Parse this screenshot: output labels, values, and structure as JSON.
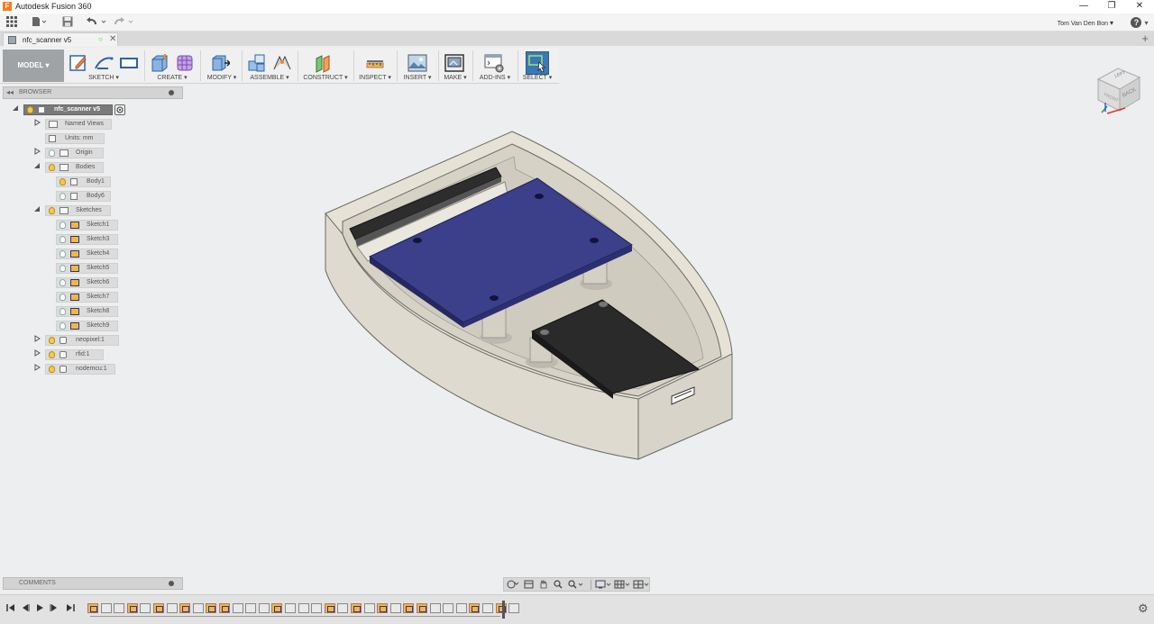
{
  "window": {
    "title": "Autodesk Fusion 360",
    "app_icon_letter": "F",
    "controls": [
      "—",
      "❐",
      "✕"
    ]
  },
  "quick_access": {
    "user_name": "Tom Van Den Bon",
    "user_chevron": "▾",
    "help_label": "?",
    "help_chevron": "▾"
  },
  "document_tab": {
    "name": "nfc_scanner v5",
    "sync": "○",
    "close": "✕",
    "add": "+"
  },
  "ribbon": {
    "workspace": "MODEL ▾",
    "groups": [
      {
        "id": "sketch",
        "label": "SKETCH ▾"
      },
      {
        "id": "create",
        "label": "CREATE ▾"
      },
      {
        "id": "modify",
        "label": "MODIFY ▾"
      },
      {
        "id": "assemble",
        "label": "ASSEMBLE ▾"
      },
      {
        "id": "construct",
        "label": "CONSTRUCT ▾"
      },
      {
        "id": "inspect",
        "label": "INSPECT ▾"
      },
      {
        "id": "insert",
        "label": "INSERT ▾"
      },
      {
        "id": "make",
        "label": "MAKE ▾"
      },
      {
        "id": "addins",
        "label": "ADD-INS ▾"
      },
      {
        "id": "select",
        "label": "SELECT ▾"
      }
    ]
  },
  "viewcube": {
    "faces": [
      "LEFT",
      "FRONT",
      "BACK"
    ]
  },
  "browser": {
    "title": "BROWSER",
    "collapse": "◂◂",
    "tree": [
      {
        "label": "nfc_scanner v5",
        "depth": 0,
        "expand": "open",
        "bulb": true,
        "icon": "doc",
        "root": true
      },
      {
        "label": "Named Views",
        "depth": 1,
        "expand": "closed",
        "bulb": false,
        "icon": "folder"
      },
      {
        "label": "Units: mm",
        "depth": 1,
        "expand": "none",
        "bulb": false,
        "icon": "doc"
      },
      {
        "label": "Origin",
        "depth": 1,
        "expand": "closed",
        "bulb": true,
        "bulb_off": true,
        "icon": "folder"
      },
      {
        "label": "Bodies",
        "depth": 1,
        "expand": "open",
        "bulb": true,
        "icon": "folder"
      },
      {
        "label": "Body1",
        "depth": 2,
        "expand": "none",
        "bulb": true,
        "icon": "body"
      },
      {
        "label": "Body6",
        "depth": 2,
        "expand": "none",
        "bulb": true,
        "bulb_off": true,
        "icon": "body"
      },
      {
        "label": "Sketches",
        "depth": 1,
        "expand": "open",
        "bulb": true,
        "icon": "folder"
      },
      {
        "label": "Sketch1",
        "depth": 2,
        "expand": "none",
        "bulb": true,
        "bulb_off": true,
        "icon": "sketch"
      },
      {
        "label": "Sketch3",
        "depth": 2,
        "expand": "none",
        "bulb": true,
        "bulb_off": true,
        "icon": "sketch"
      },
      {
        "label": "Sketch4",
        "depth": 2,
        "expand": "none",
        "bulb": true,
        "bulb_off": true,
        "icon": "sketch"
      },
      {
        "label": "Sketch5",
        "depth": 2,
        "expand": "none",
        "bulb": true,
        "bulb_off": true,
        "icon": "sketch"
      },
      {
        "label": "Sketch6",
        "depth": 2,
        "expand": "none",
        "bulb": true,
        "bulb_off": true,
        "icon": "sketch"
      },
      {
        "label": "Sketch7",
        "depth": 2,
        "expand": "none",
        "bulb": true,
        "bulb_off": true,
        "icon": "sketch"
      },
      {
        "label": "Sketch8",
        "depth": 2,
        "expand": "none",
        "bulb": true,
        "bulb_off": true,
        "icon": "sketch"
      },
      {
        "label": "Sketch9",
        "depth": 2,
        "expand": "none",
        "bulb": true,
        "bulb_off": true,
        "icon": "sketch"
      },
      {
        "label": "neopixel:1",
        "depth": 1,
        "expand": "closed",
        "bulb": true,
        "icon": "component"
      },
      {
        "label": "rfid:1",
        "depth": 1,
        "expand": "closed",
        "bulb": true,
        "icon": "component"
      },
      {
        "label": "nodemcu:1",
        "depth": 1,
        "expand": "closed",
        "bulb": true,
        "icon": "component"
      }
    ]
  },
  "comments": {
    "title": "COMMENTS"
  },
  "timeline": {
    "items": [
      "sk",
      "ft",
      "ft",
      "sk",
      "ft",
      "sk",
      "ft",
      "sk",
      "ft",
      "sk",
      "sk",
      "ft",
      "ft",
      "ft",
      "sk",
      "ft",
      "ft",
      "ft",
      "sk",
      "ft",
      "sk",
      "ft",
      "sk",
      "ft",
      "sk",
      "sk",
      "ft",
      "ft",
      "ft",
      "sk",
      "ft",
      "sk",
      "ft"
    ]
  },
  "colors": {
    "accent": "#f47c20",
    "select_active": "#3a78b5",
    "enclosure": "#e6e2d6",
    "pcb": "#3c3f8a",
    "dark_board": "#2a2a2a",
    "bulb_on": "#f7c84a"
  }
}
